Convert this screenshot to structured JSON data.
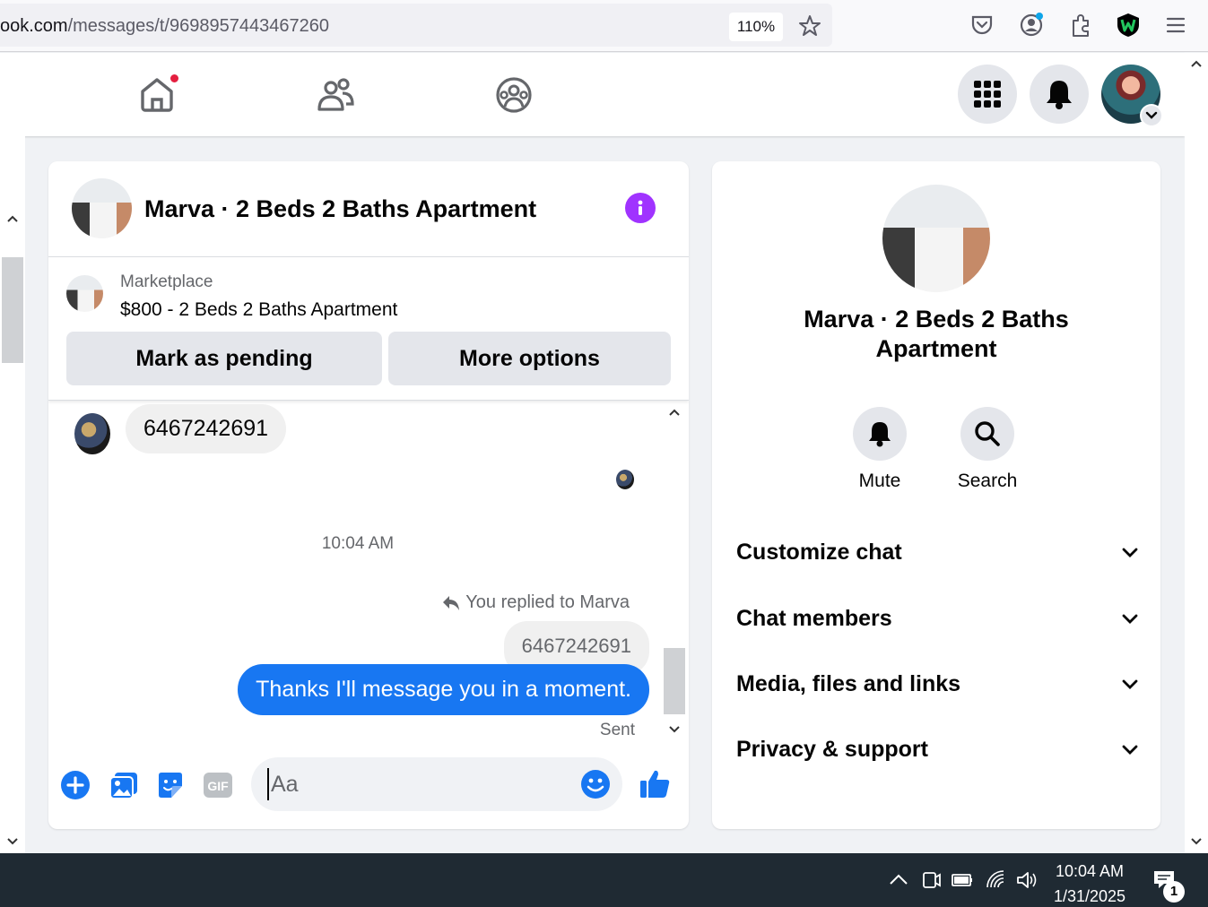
{
  "browser": {
    "url_host": "ook.com",
    "url_path": "/messages/t/9698957443467260",
    "zoom": "110%",
    "icons": [
      "bookmark-star-icon",
      "pocket-icon",
      "account-icon",
      "extensions-icon",
      "extension-w-icon",
      "menu-icon"
    ]
  },
  "fb_nav": {
    "icons": [
      "home-icon",
      "friends-icon",
      "groups-icon",
      "apps-grid-icon",
      "notifications-bell-icon"
    ]
  },
  "chat": {
    "title": "Marva · 2 Beds 2 Baths Apartment",
    "marketplace_label": "Marketplace",
    "listing": "$800 - 2 Beds 2 Baths Apartment",
    "mark_pending_label": "Mark as pending",
    "more_options_label": "More options",
    "messages": {
      "incoming_text": "6467242691",
      "timestamp": "10:04 AM",
      "replied_label": "You replied to Marva",
      "quoted_text": "6467242691",
      "outgoing_text": "Thanks I'll message you in a moment.",
      "status": "Sent"
    },
    "composer": {
      "placeholder": "Aa",
      "gif_label": "GIF"
    }
  },
  "info_panel": {
    "title": "Marva · 2 Beds 2 Baths Apartment",
    "mute_label": "Mute",
    "search_label": "Search",
    "sections": [
      "Customize chat",
      "Chat members",
      "Media, files and links",
      "Privacy & support"
    ]
  },
  "taskbar": {
    "time": "10:04 AM",
    "date": "1/31/2025",
    "notification_count": "1"
  },
  "colors": {
    "accent": "#1877f2",
    "info": "#a033ff",
    "badge": "#e41e3f"
  }
}
